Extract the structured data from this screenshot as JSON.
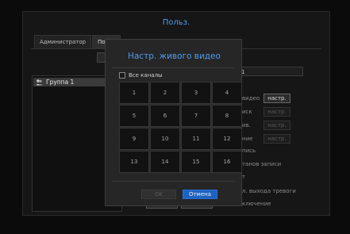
{
  "window": {
    "title": "Польз.",
    "tabs": [
      "Администратор",
      "Польз"
    ]
  },
  "group_panel": {
    "items": [
      {
        "label": "Группа 1"
      }
    ]
  },
  "right_panel": {
    "field_value": "na 1",
    "labels": [
      "видео",
      "иск",
      "ив.",
      "ние",
      "пись",
      "танов записи",
      "т",
      "л. выхода тревоги",
      "ключение"
    ],
    "buttons": [
      {
        "label": "настр.",
        "enabled": true
      },
      {
        "label": "настр.",
        "enabled": false
      },
      {
        "label": "настр.",
        "enabled": false
      },
      {
        "label": "настр.",
        "enabled": false
      }
    ]
  },
  "footer": {
    "ok_label": "OK",
    "cancel_label": "Отмена"
  },
  "dialog": {
    "title": "Настр. живого видео",
    "all_channels_label": "Все каналы",
    "all_channels_checked": false,
    "channels": [
      "1",
      "2",
      "3",
      "4",
      "5",
      "6",
      "7",
      "8",
      "9",
      "10",
      "11",
      "12",
      "13",
      "14",
      "15",
      "16"
    ],
    "ok_label": "OK",
    "ok_enabled": false,
    "cancel_label": "Отмена"
  },
  "colors": {
    "title_blue": "#4e9cf0",
    "primary_button": "#1d63c4"
  }
}
